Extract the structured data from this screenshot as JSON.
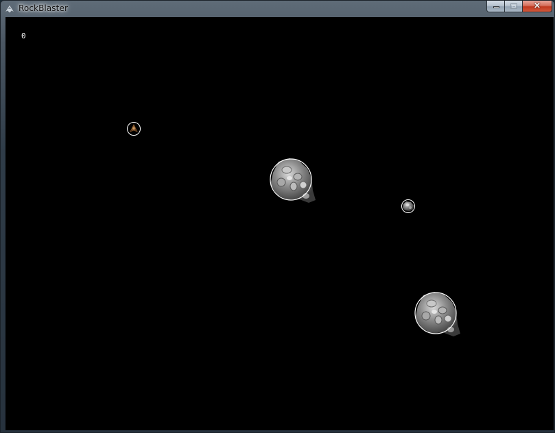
{
  "window": {
    "title": "RockBlaster",
    "icon": "spaceship-icon",
    "buttons": {
      "minimize": "minimize-icon",
      "maximize": "maximize-icon",
      "close": "×"
    }
  },
  "game": {
    "score": "0",
    "background_color": "#000000",
    "collision_circle_color": "#ffffff",
    "entities": [
      {
        "kind": "ship",
        "icon": "player-ship-icon"
      },
      {
        "kind": "asteroid-large",
        "icon": "asteroid-icon"
      },
      {
        "kind": "asteroid-small",
        "icon": "asteroid-icon"
      },
      {
        "kind": "asteroid-large",
        "icon": "asteroid-icon"
      }
    ]
  }
}
